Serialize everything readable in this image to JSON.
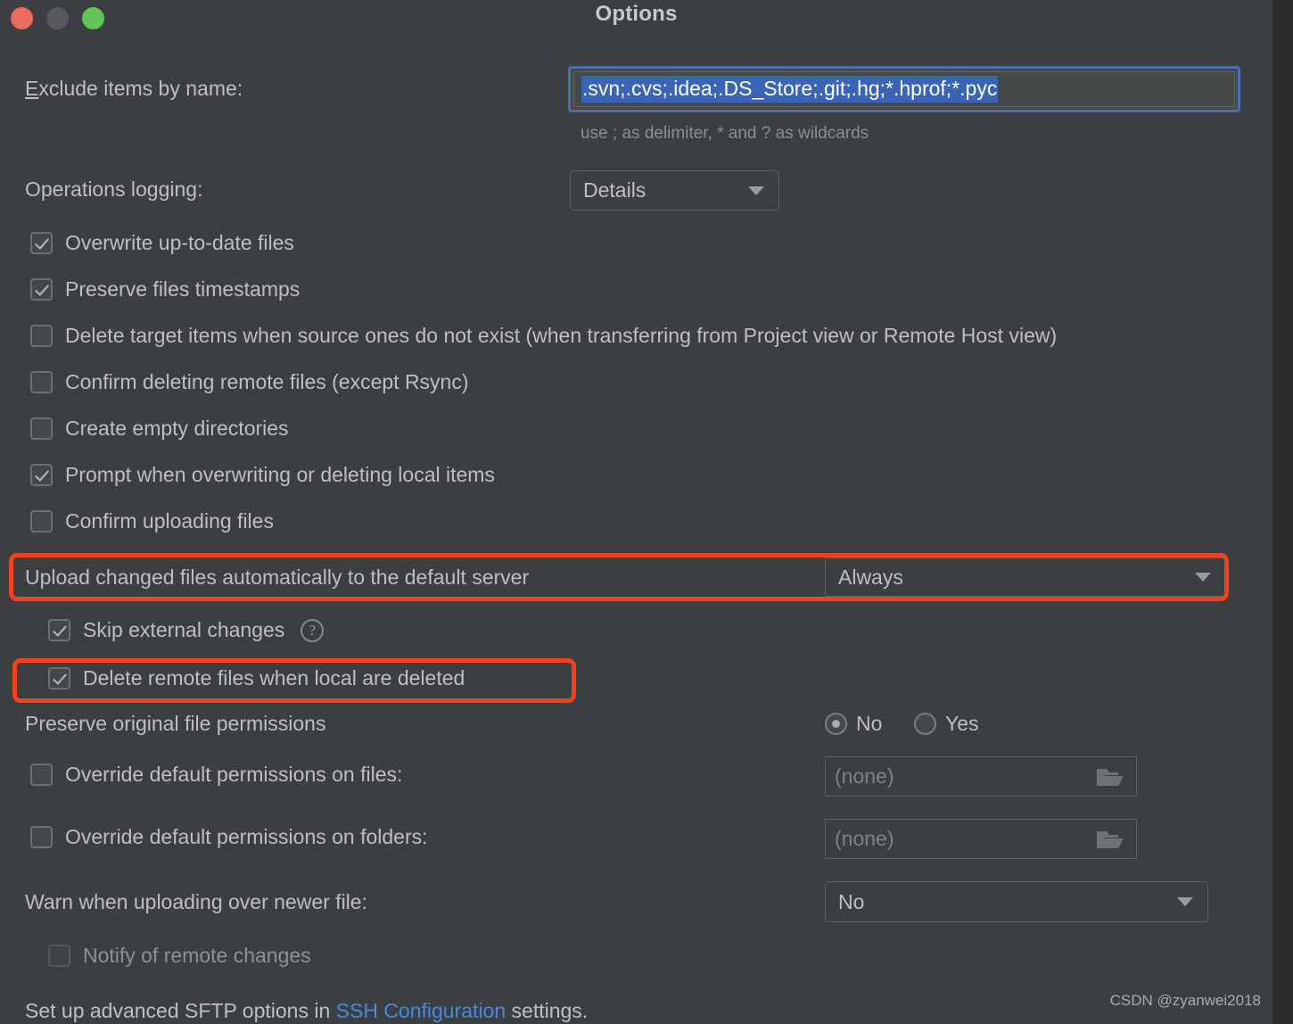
{
  "window": {
    "title": "Options",
    "controls": {
      "close": "close-button",
      "minimize": "minimize-button",
      "zoom": "zoom-button"
    }
  },
  "colors": {
    "background": "#3C3F41",
    "text": "#BEBFC1",
    "accent_selection": "#3A64B4",
    "focus_ring": "#4B6EAF",
    "annotation": "#F2421B",
    "link": "#4A88DF",
    "traffic_close": "#ED6A5E",
    "traffic_min": "#56585A",
    "traffic_zoom": "#61C454"
  },
  "exclude": {
    "label_mnemonic": "E",
    "label_rest": "xclude items by name:",
    "value": ".svn;.cvs;.idea;.DS_Store;.git;.hg;*.hprof;*.pyc",
    "hint": "use ; as delimiter, * and ? as wildcards",
    "selected": true,
    "focused": true
  },
  "operations_logging": {
    "label": "Operations logging:",
    "value": "Details",
    "options": [
      "Details"
    ]
  },
  "checkboxes": [
    {
      "label": "Overwrite up-to-date files",
      "checked": true,
      "disabled": false
    },
    {
      "label": "Preserve files timestamps",
      "checked": true,
      "disabled": false
    },
    {
      "label": "Delete target items when source ones do not exist (when transferring from Project view or Remote Host view)",
      "checked": false,
      "disabled": false
    },
    {
      "label": "Confirm deleting remote files (except Rsync)",
      "checked": false,
      "disabled": false
    },
    {
      "label": "Create empty directories",
      "checked": false,
      "disabled": false
    },
    {
      "label": "Prompt when overwriting or deleting local items",
      "checked": true,
      "disabled": false
    },
    {
      "label": "Confirm uploading files",
      "checked": false,
      "disabled": false
    }
  ],
  "upload_auto": {
    "label": "Upload changed files automatically to the default server",
    "value": "Always",
    "options": [
      "Always"
    ],
    "highlighted": true
  },
  "skip_external": {
    "label": "Skip external changes",
    "checked": true,
    "help_icon": "help-circle-icon"
  },
  "delete_remote": {
    "label": "Delete remote files when local are deleted",
    "checked": true,
    "highlighted": true
  },
  "preserve_permissions": {
    "label": "Preserve original file permissions",
    "options": [
      {
        "label": "No",
        "selected": true
      },
      {
        "label": "Yes",
        "selected": false
      }
    ]
  },
  "override_files": {
    "label": "Override default permissions on files:",
    "checked": false,
    "placeholder": "(none)",
    "browse_icon": "folder-open-icon"
  },
  "override_folders": {
    "label": "Override default permissions on folders:",
    "checked": false,
    "placeholder": "(none)",
    "browse_icon": "folder-open-icon"
  },
  "warn_newer": {
    "label": "Warn when uploading over newer file:",
    "value": "No",
    "options": [
      "No"
    ]
  },
  "notify_remote": {
    "label": "Notify of remote changes",
    "checked": false,
    "disabled": true
  },
  "footer": {
    "prefix": "Set up advanced SFTP options in",
    "link": "SSH Configuration",
    "suffix": "settings."
  },
  "watermark": "CSDN @zyanwei2018"
}
